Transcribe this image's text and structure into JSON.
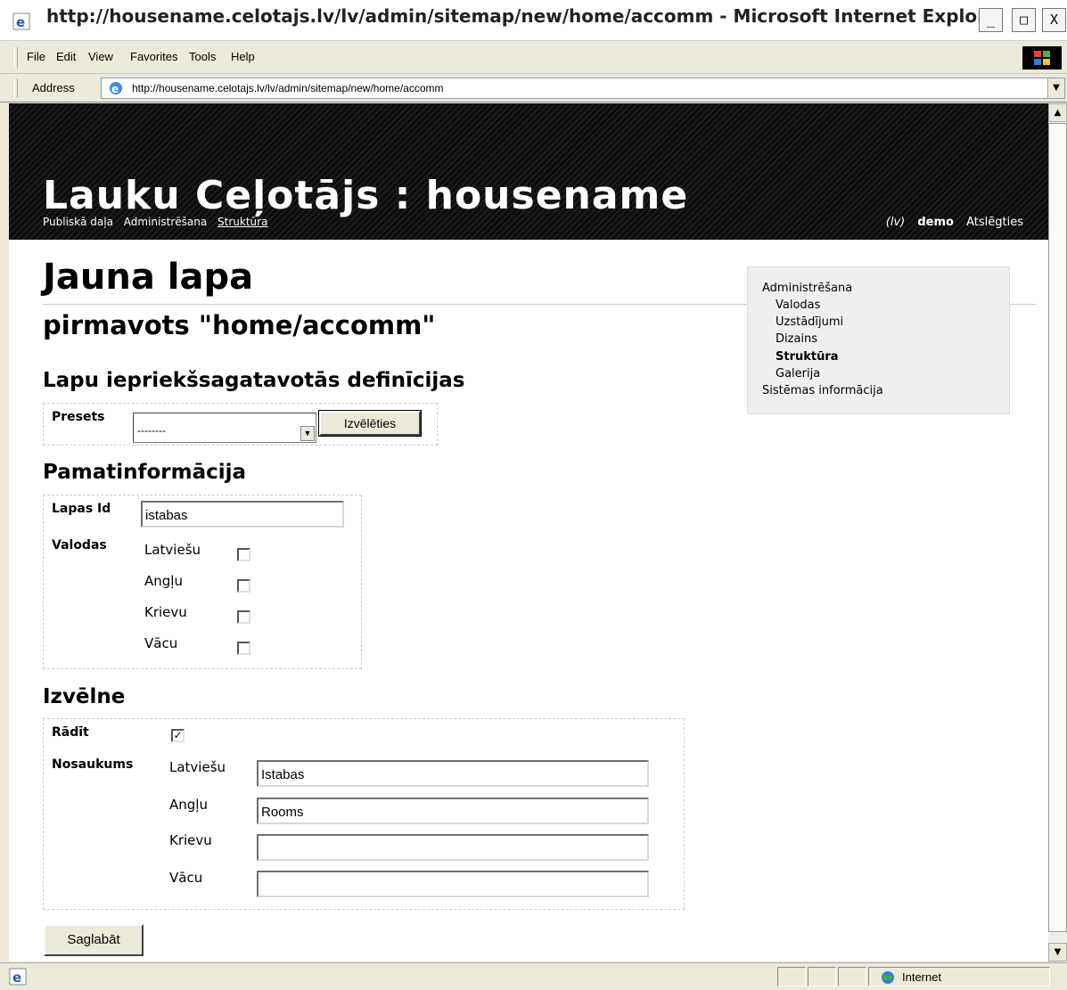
{
  "window": {
    "title": "http://housename.celotajs.lv/lv/admin/sitemap/new/home/accomm - Microsoft Internet Explore",
    "buttons": {
      "minimize": "_",
      "maximize": "□",
      "close": "X"
    }
  },
  "menubar": {
    "items": [
      "File",
      "Edit",
      "View",
      "Favorites",
      "Tools",
      "Help"
    ]
  },
  "addressbar": {
    "label": "Address",
    "url": "http://housename.celotajs.lv/lv/admin/sitemap/new/home/accomm"
  },
  "site": {
    "title": "Lauku Ceļotājs : housename",
    "nav": [
      "Publiskā daļa",
      "Administrēšana",
      "Struktūra"
    ],
    "lang": "(lv)",
    "user": "demo",
    "logout": "Atslēgties"
  },
  "page": {
    "title": "Jauna lapa",
    "subtitle": "pirmavots \"home/accomm\""
  },
  "presets": {
    "heading": "Lapu iepriekšsagatavotās definīcijas",
    "label": "Presets",
    "selected": "--------",
    "button": "Izvēlēties"
  },
  "basic": {
    "heading": "Pamatinformācija",
    "id_label": "Lapas Id",
    "id_value": "istabas",
    "languages_label": "Valodas",
    "languages": [
      {
        "name": "Latviešu",
        "checked": false
      },
      {
        "name": "Angļu",
        "checked": false
      },
      {
        "name": "Krievu",
        "checked": false
      },
      {
        "name": "Vācu",
        "checked": false
      }
    ]
  },
  "menu": {
    "heading": "Izvēlne",
    "show_label": "Rādīt",
    "show_checked": true,
    "check_mark": "✓",
    "name_label": "Nosaukums",
    "names": [
      {
        "lang": "Latviešu",
        "value": "Istabas"
      },
      {
        "lang": "Angļu",
        "value": "Rooms"
      },
      {
        "lang": "Krievu",
        "value": ""
      },
      {
        "lang": "Vācu",
        "value": ""
      }
    ]
  },
  "save_button": "Saglabāt",
  "sidebar": {
    "items": [
      {
        "label": "Administrēšana",
        "level": 0
      },
      {
        "label": "Valodas",
        "level": 1
      },
      {
        "label": "Uzstādījumi",
        "level": 1
      },
      {
        "label": "Dizains",
        "level": 1
      },
      {
        "label": "Struktūra",
        "level": 1,
        "current": true
      },
      {
        "label": "Galerija",
        "level": 1
      },
      {
        "label": "Sistēmas informācija",
        "level": 0
      }
    ]
  },
  "statusbar": {
    "zone": "Internet"
  },
  "icons": [
    "ie-page-icon",
    "windows-logo-icon",
    "globe-icon"
  ]
}
